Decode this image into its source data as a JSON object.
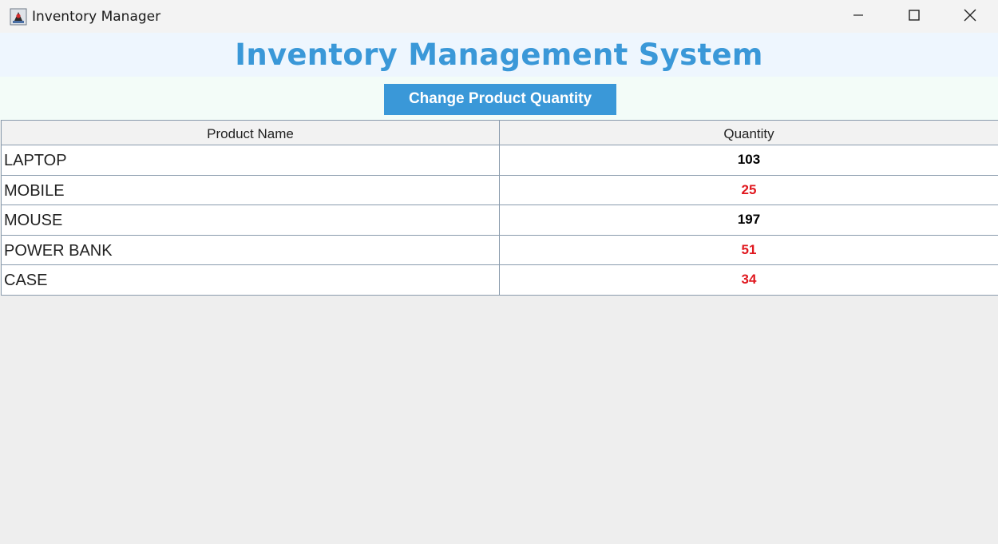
{
  "window": {
    "title": "Inventory Manager"
  },
  "header": {
    "title": "Inventory Management System"
  },
  "toolbar": {
    "change_button_label": "Change Product Quantity"
  },
  "table": {
    "columns": [
      "Product Name",
      "Quantity"
    ],
    "rows": [
      {
        "name": "LAPTOP",
        "quantity": "103",
        "status": "ok"
      },
      {
        "name": "MOBILE",
        "quantity": "25",
        "status": "low"
      },
      {
        "name": "MOUSE",
        "quantity": "197",
        "status": "ok"
      },
      {
        "name": "POWER BANK",
        "quantity": "51",
        "status": "low"
      },
      {
        "name": "CASE",
        "quantity": "34",
        "status": "low"
      }
    ]
  },
  "colors": {
    "accent": "#3a98d8",
    "low_stock": "#e0181f",
    "normal_stock": "#000000"
  },
  "icons": {
    "app": "java-duke-icon",
    "minimize": "minimize-icon",
    "maximize": "maximize-icon",
    "close": "close-icon"
  }
}
